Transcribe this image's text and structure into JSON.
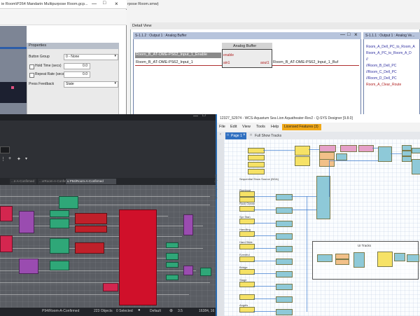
{
  "top_window": {
    "title": "ie Room\\P264 Mandarin Multipurpose Room.gcp...",
    "second_title": "rpose Room.smw)",
    "properties": {
      "header": "Properties",
      "button_group_label": "Button Group",
      "button_group_value": "0 - None",
      "hold_time_label": "Hold Time (secs)",
      "hold_time_value": "0.0",
      "repeat_rate_label": "Repeat Rate (secs)",
      "repeat_rate_value": "0.0",
      "press_feedback_label": "Press Feedback",
      "press_feedback_value": "State"
    }
  },
  "detail_view": {
    "label": "Detail View",
    "symbol_window_title": "S-1.1.2 : Output 1 : Analog Buffer",
    "symbol_window2_title": "S-1.1.1 : Output 1 : Analog Ve...",
    "buffer": {
      "title": "Analog Buffer",
      "enable": "enable",
      "ain1": "ain1",
      "aout1": "aout1"
    },
    "signal_enable": "Room_B_AT-OME-PS62_Input_1_Enable",
    "signal_input": "Room_B_AT-OME-PS62_Input_1",
    "signal_output": "Room_B_AT-OME-PS62_Input_1_Buf",
    "right_signals": [
      "Room_A_Dell_PC_to_Room_A",
      "Room_A_PC_to_Room_A_D",
      "//",
      "//Room_B_Dell_PC",
      "//Room_C_Dell_PC",
      "//Room_D_Dell_PC",
      "Room_A_Clear_Route"
    ]
  },
  "dark_app": {
    "tabs": [
      "...n-A-Confirmed",
      "...vrRoom-A-Confirmed",
      "u P94/Room-A-Confirmed"
    ],
    "status_room": "P94/Room-A-Confirmed",
    "status_objects": "223 Objects",
    "status_selected": "0 Selected",
    "status_mode": "Default",
    "status_zoom": "3.5",
    "status_coords": "16384, 16"
  },
  "qsys": {
    "title": "12327_S2974 - WCS-Aquarium Sea Lion Aquatheater-Rev2 - Q-SYS Designer [9.8.0]",
    "menu": [
      "File",
      "Edit",
      "View",
      "Tools",
      "Help"
    ],
    "licensed": "Licensed Features (3)",
    "tabs": [
      "Page 1",
      "Full Show Tracks"
    ],
    "side_label": "Design Schematic",
    "source_labels": [
      "Sequential Show Source (BGA)",
      "Rumbout",
      "Rock Ocean",
      "Spr Stan",
      "Handling",
      "Hard Slide",
      "Eventful",
      "Bridge",
      "Stage",
      "Angels"
    ],
    "group_label": "UI Tracks"
  }
}
